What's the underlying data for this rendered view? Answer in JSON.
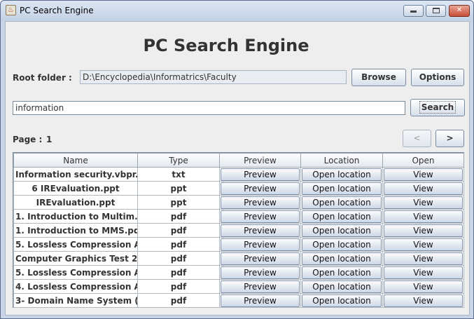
{
  "window": {
    "title": "PC Search Engine"
  },
  "heading": "PC Search Engine",
  "root": {
    "label": "Root folder :",
    "value": "D:\\Encyclopedia\\Informatrics\\Faculty",
    "browse": "Browse",
    "options": "Options"
  },
  "search": {
    "value": "information",
    "button": "Search"
  },
  "paging": {
    "label": "Page :",
    "page": "1",
    "prev": "<",
    "next": ">"
  },
  "table": {
    "headers": [
      "Name",
      "Type",
      "Preview",
      "Location",
      "Open"
    ],
    "rows": [
      {
        "name": "Information security.vbpr...",
        "type": "txt",
        "preview": "Preview",
        "location": "Open location",
        "open": "View"
      },
      {
        "name": "6 IREvaluation.ppt",
        "type": "ppt",
        "preview": "Preview",
        "location": "Open location",
        "open": "View"
      },
      {
        "name": "IREvaluation.ppt",
        "type": "ppt",
        "preview": "Preview",
        "location": "Open location",
        "open": "View"
      },
      {
        "name": "1. Introduction to Multim...",
        "type": "pdf",
        "preview": "Preview",
        "location": "Open location",
        "open": "View"
      },
      {
        "name": "1. Introduction to MMS.pdf",
        "type": "pdf",
        "preview": "Preview",
        "location": "Open location",
        "open": "View"
      },
      {
        "name": "5. Lossless Compression A...",
        "type": "pdf",
        "preview": "Preview",
        "location": "Open location",
        "open": "View"
      },
      {
        "name": "Computer Graphics Test 2....",
        "type": "pdf",
        "preview": "Preview",
        "location": "Open location",
        "open": "View"
      },
      {
        "name": "5. Lossless Compression A...",
        "type": "pdf",
        "preview": "Preview",
        "location": "Open location",
        "open": "View"
      },
      {
        "name": "4. Lossless Compression A...",
        "type": "pdf",
        "preview": "Preview",
        "location": "Open location",
        "open": "View"
      },
      {
        "name": "3- Domain Name System (...",
        "type": "pdf",
        "preview": "Preview",
        "location": "Open location",
        "open": "View"
      }
    ]
  },
  "icons": {
    "app": "java-cup-icon",
    "minimize": "minimize-icon",
    "maximize": "maximize-icon",
    "close": "close-icon"
  },
  "colors": {
    "titlebar": "#c4d2e6",
    "panel": "#eeeeee",
    "close": "#c7503a"
  }
}
